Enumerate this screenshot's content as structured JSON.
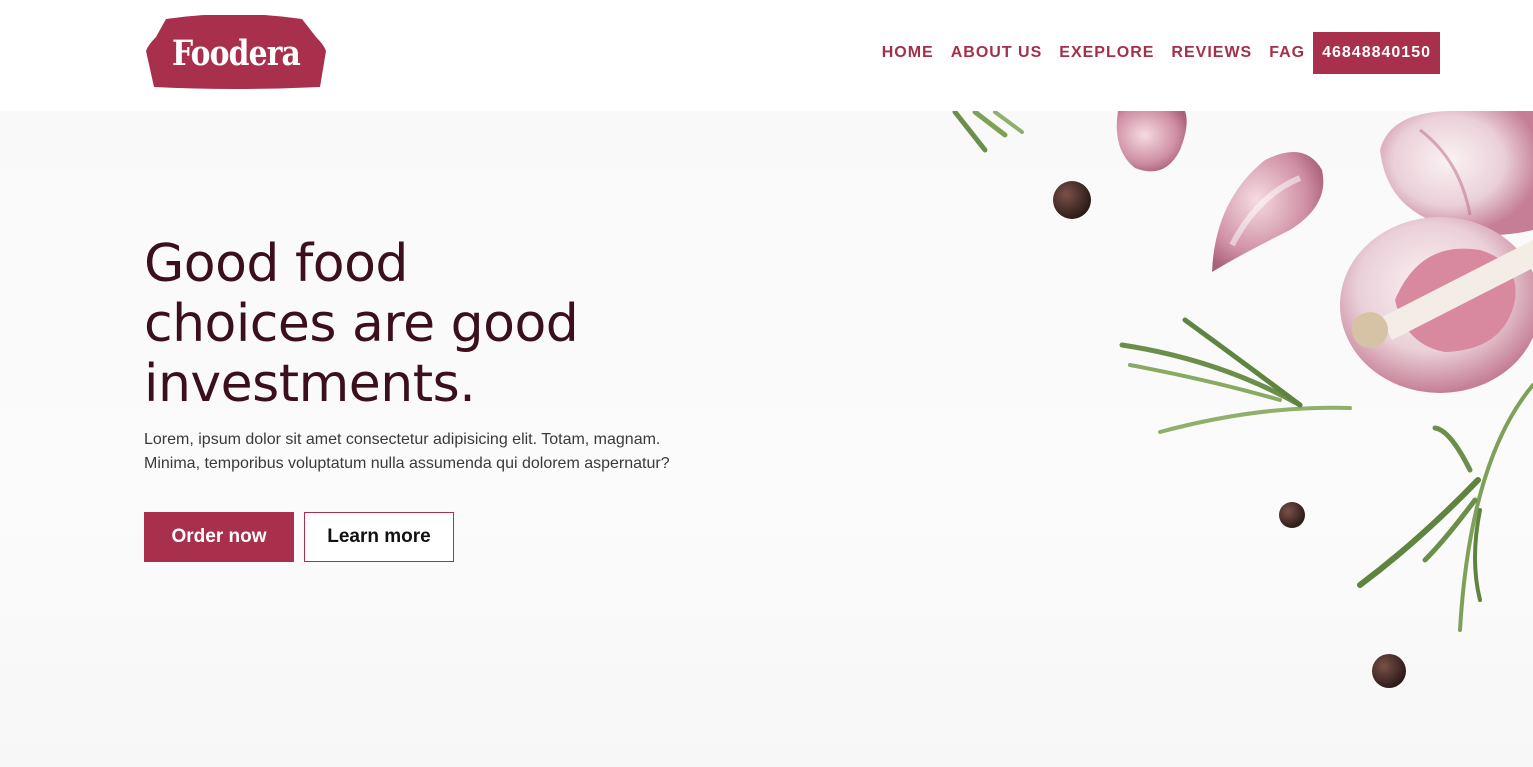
{
  "colors": {
    "brand": "#a8304d",
    "headline": "#3b0f1c",
    "body_text": "#3a3a3a"
  },
  "header": {
    "logo_text": "Foodera",
    "nav": [
      "HOME",
      "ABOUT US",
      "EXEPLORE",
      "REVIEWS",
      "FAG"
    ],
    "phone": "46848840150"
  },
  "hero": {
    "headline_lines": [
      "Good food",
      "choices are good",
      "investments."
    ],
    "subtext_lines": [
      "Lorem, ipsum dolor sit amet consectetur adipisicing elit. Totam, magnam.",
      "Minima, temporibus voluptatum nulla assumenda qui dolorem aspernatur?"
    ],
    "order_label": "Order now",
    "learn_label": "Learn more",
    "image_icon": "garlic-rosemary-peppercorn-photo"
  }
}
